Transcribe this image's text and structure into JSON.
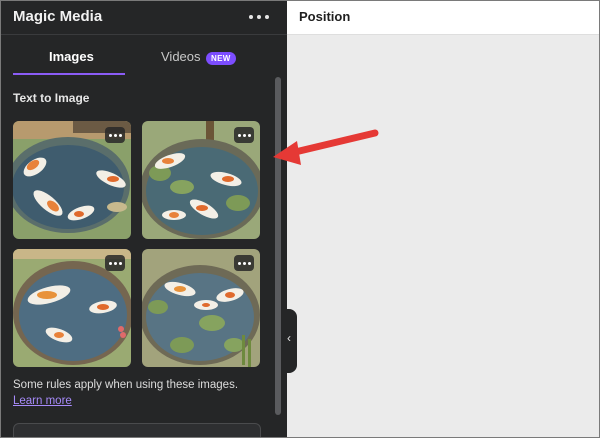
{
  "panel": {
    "title": "Magic Media",
    "tabs": [
      {
        "label": "Images",
        "active": true
      },
      {
        "label": "Videos",
        "badge": "NEW"
      }
    ],
    "section_title": "Text to Image",
    "images": [
      {
        "name": "koi-pond-image-1"
      },
      {
        "name": "koi-pond-image-2"
      },
      {
        "name": "koi-pond-image-3"
      },
      {
        "name": "koi-pond-image-4"
      }
    ],
    "rules_text": "Some rules apply when using these images.",
    "rules_link": "Learn more",
    "accent_color": "#8b5cf6",
    "badge_color": "#7c4dff"
  },
  "right_panel": {
    "header_label": "Position"
  },
  "annotation": {
    "arrow_color": "#e53935",
    "points_to": "koi-pond-image-2"
  }
}
